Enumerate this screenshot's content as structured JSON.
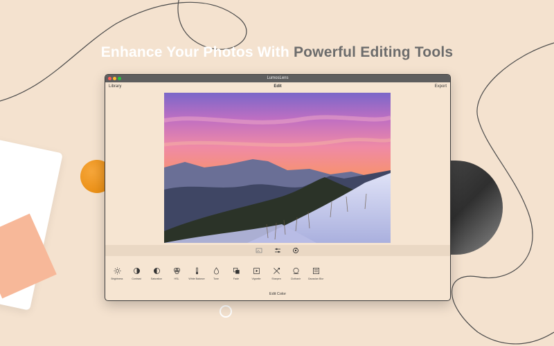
{
  "headline": {
    "part_light": "Enhance Your Photos With ",
    "part_dark": "Powerful Editing Tools",
    "color_light": "#ffffff",
    "color_dark": "#6c6c6c"
  },
  "window": {
    "title": "LumosLens",
    "nav": {
      "left": "Library",
      "center": "Edit",
      "right": "Export"
    },
    "mode_icons": [
      "adjust-image-icon",
      "sliders-icon",
      "rotate-icon"
    ],
    "tools": [
      {
        "label": "Brightness",
        "icon": "sun-icon"
      },
      {
        "label": "Contrast",
        "icon": "contrast-icon"
      },
      {
        "label": "Saturation",
        "icon": "saturation-icon"
      },
      {
        "label": "HSL",
        "icon": "hsl-icon"
      },
      {
        "label": "White Balance",
        "icon": "thermometer-icon"
      },
      {
        "label": "Tone",
        "icon": "drop-icon"
      },
      {
        "label": "Fade",
        "icon": "fade-icon"
      },
      {
        "label": "Vignette",
        "icon": "vignette-icon"
      },
      {
        "label": "Sharpen",
        "icon": "sharpen-icon"
      },
      {
        "label": "Clothanir",
        "icon": "clarity-icon"
      },
      {
        "label": "Gaussian Blur",
        "icon": "blur-icon"
      }
    ],
    "footer": "Edit Color"
  },
  "colors": {
    "background": "#f4e2cf",
    "accent_orange": "#f29a1f",
    "peach": "#f7b899",
    "titlebar": "#5e5e5e"
  }
}
